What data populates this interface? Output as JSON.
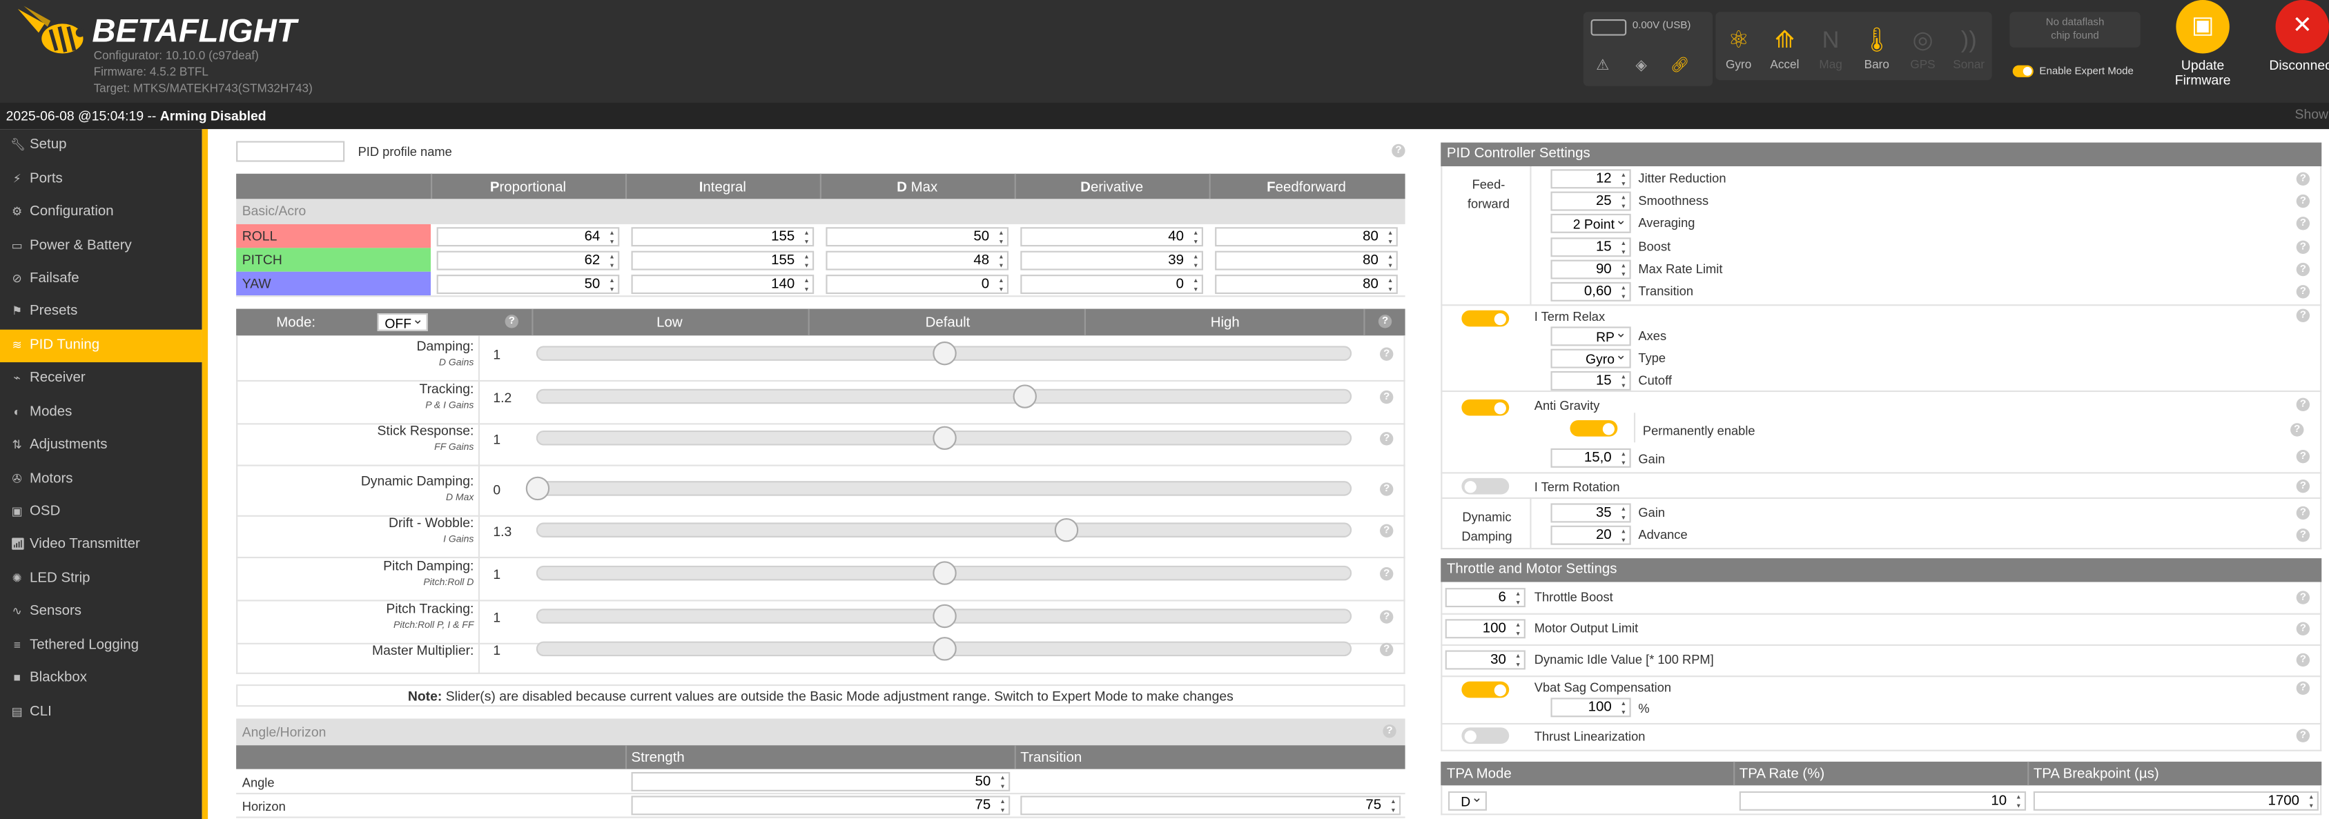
{
  "header": {
    "brand": "BETAFLIGHT",
    "configurator": "Configurator: 10.10.0 (c97deaf)",
    "firmware": "Firmware: 4.5.2 BTFL",
    "target": "Target: MTKS/MATEKH743(STM32H743)",
    "battery": "0.00V (USB)",
    "sensors": [
      {
        "label": "Gyro",
        "icon": "gyro-icon",
        "on": true
      },
      {
        "label": "Accel",
        "icon": "accel-icon",
        "on": true
      },
      {
        "label": "Mag",
        "icon": "mag-icon",
        "on": false
      },
      {
        "label": "Baro",
        "icon": "baro-icon",
        "on": true
      },
      {
        "label": "GPS",
        "icon": "gps-icon",
        "on": false
      },
      {
        "label": "Sonar",
        "icon": "sonar-icon",
        "on": false
      }
    ],
    "dataflash_line1": "No dataflash",
    "dataflash_line2": "chip found",
    "expert_mode": "Enable Expert Mode",
    "update_l1": "Update",
    "update_l2": "Firmware",
    "disconnect": "Disconnect"
  },
  "status": {
    "time": "2025-06-08 @15:04:19 -- ",
    "arming": "Arming Disabled",
    "show": "Show"
  },
  "sidebar": [
    {
      "label": "Setup",
      "icon": "wrench-icon"
    },
    {
      "label": "Ports",
      "icon": "plug-icon"
    },
    {
      "label": "Configuration",
      "icon": "gear-icon"
    },
    {
      "label": "Power & Battery",
      "icon": "battery-icon"
    },
    {
      "label": "Failsafe",
      "icon": "failsafe-icon"
    },
    {
      "label": "Presets",
      "icon": "presets-icon"
    },
    {
      "label": "PID Tuning",
      "icon": "pid-icon",
      "active": true
    },
    {
      "label": "Receiver",
      "icon": "receiver-icon"
    },
    {
      "label": "Modes",
      "icon": "modes-icon"
    },
    {
      "label": "Adjustments",
      "icon": "adjust-icon"
    },
    {
      "label": "Motors",
      "icon": "motor-icon"
    },
    {
      "label": "OSD",
      "icon": "osd-icon"
    },
    {
      "label": "Video Transmitter",
      "icon": "vtx-icon"
    },
    {
      "label": "LED Strip",
      "icon": "led-icon"
    },
    {
      "label": "Sensors",
      "icon": "sensors-icon"
    },
    {
      "label": "Tethered Logging",
      "icon": "log-icon"
    },
    {
      "label": "Blackbox",
      "icon": "blackbox-icon"
    },
    {
      "label": "CLI",
      "icon": "cli-icon"
    }
  ],
  "pid": {
    "profile_name_label": "PID profile name",
    "profile_name_value": "",
    "cols": [
      {
        "b": "P",
        "r": "roportional"
      },
      {
        "b": "I",
        "r": "ntegral"
      },
      {
        "b": "D",
        "r": " Max"
      },
      {
        "b": "D",
        "r": "erivative"
      },
      {
        "b": "F",
        "r": "eedforward"
      }
    ],
    "section": "Basic/Acro",
    "rows": [
      {
        "axis": "ROLL",
        "color": "#ff8a8a",
        "vals": [
          "64",
          "155",
          "50",
          "40",
          "80"
        ]
      },
      {
        "axis": "PITCH",
        "color": "#7fe67f",
        "vals": [
          "62",
          "155",
          "48",
          "39",
          "80"
        ]
      },
      {
        "axis": "YAW",
        "color": "#8a8aff",
        "vals": [
          "50",
          "140",
          "0",
          "0",
          "80"
        ]
      }
    ]
  },
  "sliders": {
    "mode_label": "Mode:",
    "mode_value": "OFF",
    "low": "Low",
    "default": "Default",
    "high": "High",
    "items": [
      {
        "label": "Damping:",
        "sub": "D Gains",
        "value": "1",
        "pos": 0.5
      },
      {
        "label": "Tracking:",
        "sub": "P & I Gains",
        "value": "1.2",
        "pos": 0.6
      },
      {
        "label": "Stick Response:",
        "sub": "FF Gains",
        "value": "1",
        "pos": 0.5
      },
      {
        "label": "Dynamic Damping:",
        "sub": "D Max",
        "value": "0",
        "pos": 0.0
      },
      {
        "label": "Drift - Wobble:",
        "sub": "I Gains",
        "value": "1.3",
        "pos": 0.65
      },
      {
        "label": "Pitch Damping:",
        "sub": "Pitch:Roll D",
        "value": "1",
        "pos": 0.5
      },
      {
        "label": "Pitch Tracking:",
        "sub": "Pitch:Roll P, I & FF",
        "value": "1",
        "pos": 0.5
      },
      {
        "label": "Master Multiplier:",
        "sub": "",
        "value": "1",
        "pos": 0.5
      }
    ],
    "note_bold": "Note:",
    "note": " Slider(s) are disabled because current values are outside the Basic Mode adjustment range. Switch to Expert Mode to make changes"
  },
  "angle": {
    "title": "Angle/Horizon",
    "strength": "Strength",
    "transition": "Transition",
    "rows": [
      {
        "label": "Angle",
        "strength": "50",
        "transition": ""
      },
      {
        "label": "Horizon",
        "strength": "75",
        "transition": "75"
      }
    ]
  },
  "controller": {
    "title": "PID Controller Settings",
    "ff_label_1": "Feed-",
    "ff_label_2": "forward",
    "ff": [
      {
        "value": "12",
        "label": "Jitter Reduction",
        "type": "num"
      },
      {
        "value": "25",
        "label": "Smoothness",
        "type": "num"
      },
      {
        "value": "2 Point",
        "label": "Averaging",
        "type": "sel"
      },
      {
        "value": "15",
        "label": "Boost",
        "type": "num"
      },
      {
        "value": "90",
        "label": "Max Rate Limit",
        "type": "num"
      },
      {
        "value": "0,60",
        "label": "Transition",
        "type": "num"
      }
    ],
    "iterm_relax": "I Term Relax",
    "relax": [
      {
        "value": "RP",
        "label": "Axes"
      },
      {
        "value": "Gyro",
        "label": "Type"
      },
      {
        "value": "15",
        "label": "Cutoff"
      }
    ],
    "anti_gravity": "Anti Gravity",
    "perm_enable": "Permanently enable",
    "ag_gain_value": "15,0",
    "ag_gain_label": "Gain",
    "iterm_rotation": "I Term Rotation",
    "dyn_label_1": "Dynamic",
    "dyn_label_2": "Damping",
    "dyn": [
      {
        "value": "35",
        "label": "Gain"
      },
      {
        "value": "20",
        "label": "Advance"
      }
    ]
  },
  "throttle": {
    "title": "Throttle and Motor Settings",
    "rows": [
      {
        "value": "6",
        "label": "Throttle Boost"
      },
      {
        "value": "100",
        "label": "Motor Output Limit"
      },
      {
        "value": "30",
        "label": "Dynamic Idle Value [* 100 RPM]"
      }
    ],
    "vbat": "Vbat Sag Compensation",
    "vbat_value": "100",
    "vbat_unit": "%",
    "thrust": "Thrust Linearization"
  },
  "tpa": {
    "mode_h": "TPA Mode",
    "rate_h": "TPA Rate (%)",
    "bp_h": "TPA Breakpoint (µs)",
    "mode": "D",
    "rate": "10",
    "bp": "1700"
  },
  "colors": {
    "accent": "#ffbb00",
    "header": "#303030",
    "sidebar": "#2e2e2e",
    "grey_header": "#808080"
  }
}
